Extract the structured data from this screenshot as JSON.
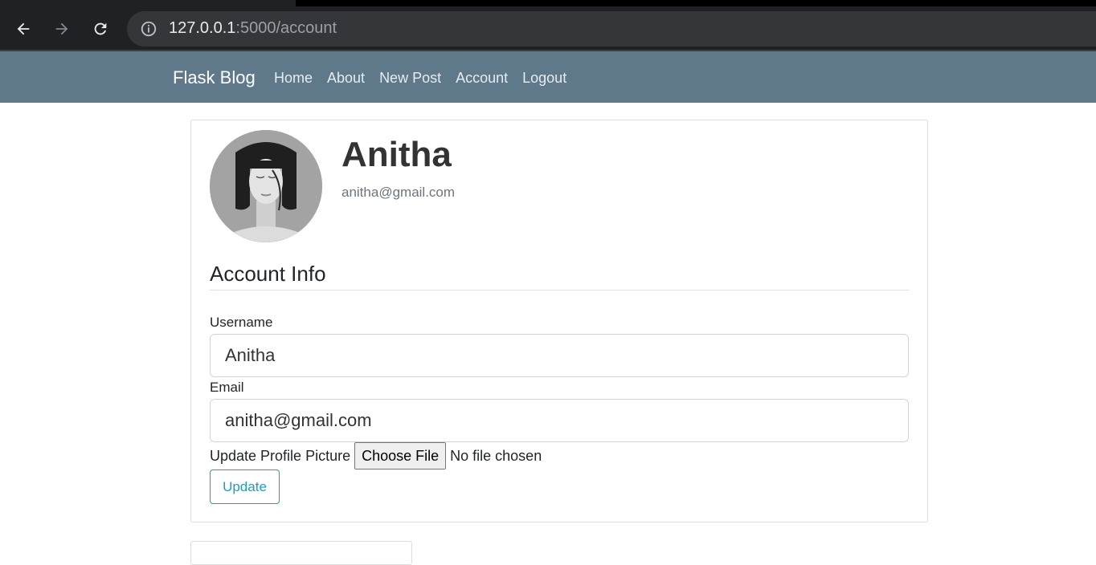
{
  "browser": {
    "url_host": "127.0.0.1",
    "url_rest": ":5000/account"
  },
  "navbar": {
    "brand": "Flask Blog",
    "links": [
      "Home",
      "About",
      "New Post",
      "Account",
      "Logout"
    ]
  },
  "account": {
    "username_display": "Anitha",
    "email_display": "anitha@gmail.com",
    "legend": "Account Info",
    "username_label": "Username",
    "username_value": "Anitha",
    "email_label": "Email",
    "email_value": "anitha@gmail.com",
    "picture_label": "Update Profile Picture",
    "file_button": "Choose File",
    "file_status": "No file chosen",
    "submit_label": "Update"
  },
  "colors": {
    "navbar_bg": "#5f788a",
    "accent": "#17a2b8"
  }
}
